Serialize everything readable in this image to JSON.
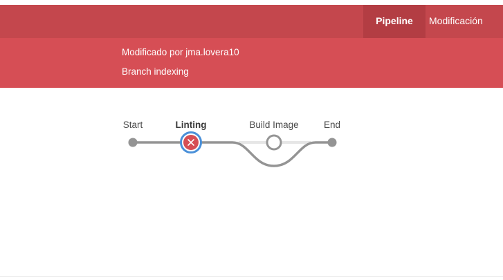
{
  "nav": {
    "tabs": [
      {
        "label": "Pipeline",
        "active": true
      },
      {
        "label": "Modificación",
        "active": false
      }
    ]
  },
  "run_info": {
    "modified_by": "Modificado por jma.lovera10",
    "cause": "Branch indexing"
  },
  "pipeline": {
    "stages": [
      {
        "label": "Start",
        "status": "start"
      },
      {
        "label": "Linting",
        "status": "failed",
        "selected": true
      },
      {
        "label": "Build Image",
        "status": "not-built"
      },
      {
        "label": "End",
        "status": "end"
      }
    ]
  },
  "colors": {
    "nav_bg": "#c4474d",
    "nav_active_bg": "#b33d43",
    "info_bg": "#d64e55",
    "failed": "#d64e55",
    "selected_ring": "#4a90d9",
    "track": "#949494",
    "track_light": "#e6e6e6"
  }
}
